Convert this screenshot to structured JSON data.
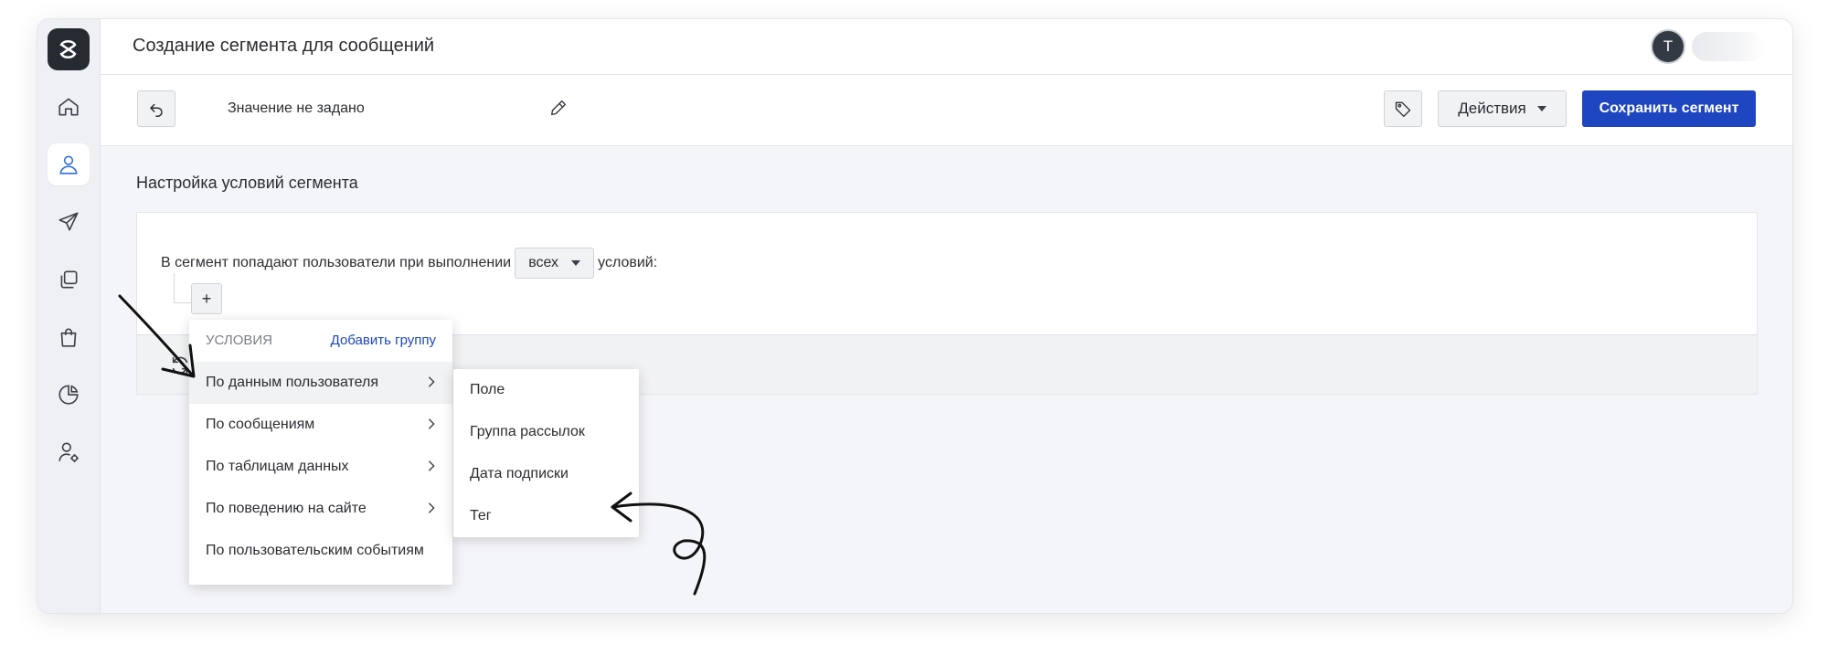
{
  "page": {
    "title": "Создание сегмента для сообщений"
  },
  "sidebar": {
    "items": [
      {
        "icon": "home-icon"
      },
      {
        "icon": "user-icon",
        "active": true
      },
      {
        "icon": "send-icon"
      },
      {
        "icon": "copy-icon"
      },
      {
        "icon": "shopping-bag-icon"
      },
      {
        "icon": "pie-chart-icon"
      },
      {
        "icon": "user-settings-icon"
      }
    ]
  },
  "header": {
    "avatar_initial": "T"
  },
  "toolbar": {
    "value_text": "Значение не задано",
    "actions_label": "Действия",
    "save_label": "Сохранить сегмент"
  },
  "section": {
    "title": "Настройка условий сегмента"
  },
  "conditions": {
    "sentence_before": "В сегмент попадают пользователи при выполнении",
    "mode_value": "всех",
    "sentence_after": "условий:",
    "add_label": "+"
  },
  "menu": {
    "caption": "УСЛОВИЯ",
    "add_group": "Добавить группу",
    "items": [
      {
        "label": "По данным пользователя",
        "has_submenu": true
      },
      {
        "label": "По сообщениям",
        "has_submenu": true
      },
      {
        "label": "По таблицам данных",
        "has_submenu": true
      },
      {
        "label": "По поведению на сайте",
        "has_submenu": true
      },
      {
        "label": "По пользовательским событиям",
        "has_submenu": false
      }
    ]
  },
  "submenu": {
    "items": [
      "Поле",
      "Группа рассылок",
      "Дата подписки",
      "Тег"
    ]
  },
  "colors": {
    "primary": "#1e46c1",
    "active_nav": "#2f6fe0",
    "sidebar_bg": "#eef0f4"
  }
}
